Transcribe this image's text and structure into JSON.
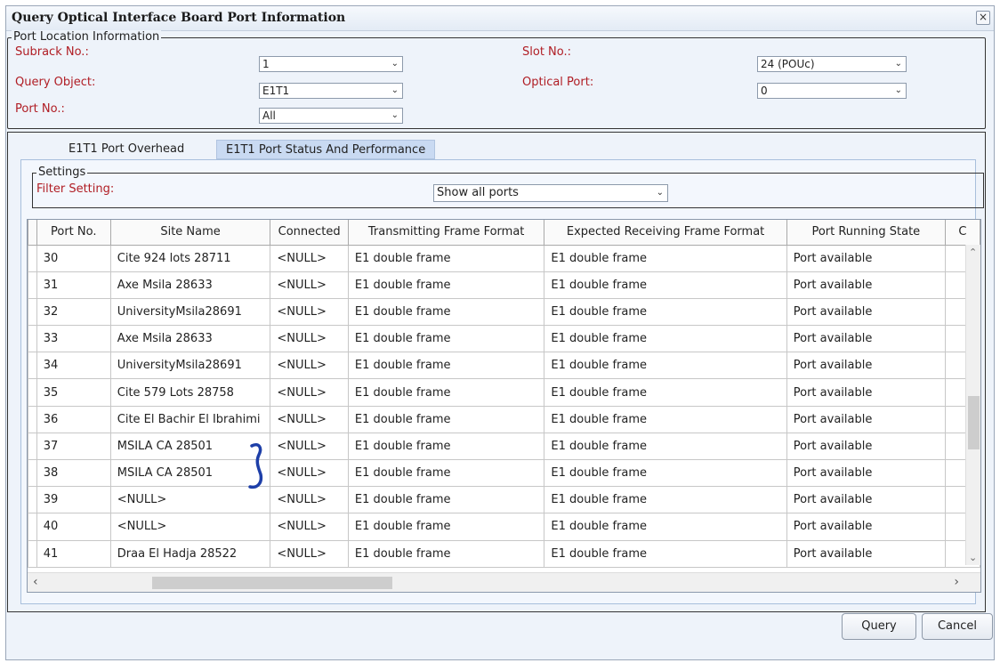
{
  "window": {
    "title": "Query Optical Interface Board Port Information",
    "close_glyph": "×"
  },
  "location": {
    "legend": "Port Location Information",
    "subrack_label": "Subrack No.:",
    "subrack_value": "1",
    "slot_label": "Slot No.:",
    "slot_value": "24 (POUc)",
    "query_object_label": "Query Object:",
    "query_object_value": "E1T1",
    "optical_port_label": "Optical Port:",
    "optical_port_value": "0",
    "port_no_label": "Port No.:",
    "port_no_value": "All"
  },
  "tabs": [
    {
      "label": "E1T1 Port Overhead",
      "active": false
    },
    {
      "label": "E1T1 Port Status And Performance",
      "active": true
    }
  ],
  "settings": {
    "legend": "Settings",
    "filter_label": "Filter Setting:",
    "filter_value": "Show all ports"
  },
  "table": {
    "columns": [
      "Port No.",
      "Site Name",
      "Connected",
      "Transmitting Frame Format",
      "Expected Receiving Frame Format",
      "Port Running State",
      "C"
    ],
    "rows": [
      [
        "30",
        "Cite 924 lots 28711",
        "<NULL>",
        "E1 double frame",
        "E1 double frame",
        "Port available"
      ],
      [
        "31",
        "Axe Msila 28633",
        "<NULL>",
        "E1 double frame",
        "E1 double frame",
        "Port available"
      ],
      [
        "32",
        "UniversityMsila28691",
        "<NULL>",
        "E1 double frame",
        "E1 double frame",
        "Port available"
      ],
      [
        "33",
        "Axe Msila 28633",
        "<NULL>",
        "E1 double frame",
        "E1 double frame",
        "Port available"
      ],
      [
        "34",
        "UniversityMsila28691",
        "<NULL>",
        "E1 double frame",
        "E1 double frame",
        "Port available"
      ],
      [
        "35",
        "Cite 579 Lots 28758",
        "<NULL>",
        "E1 double frame",
        "E1 double frame",
        "Port available"
      ],
      [
        "36",
        "Cite El Bachir El Ibrahimi",
        "<NULL>",
        "E1 double frame",
        "E1 double frame",
        "Port available"
      ],
      [
        "37",
        "MSILA CA 28501",
        "<NULL>",
        "E1 double frame",
        "E1 double frame",
        "Port available"
      ],
      [
        "38",
        "MSILA CA 28501",
        "<NULL>",
        "E1 double frame",
        "E1 double frame",
        "Port available"
      ],
      [
        "39",
        "<NULL>",
        "<NULL>",
        "E1 double frame",
        "E1 double frame",
        "Port available"
      ],
      [
        "40",
        "<NULL>",
        "<NULL>",
        "E1 double frame",
        "E1 double frame",
        "Port available"
      ],
      [
        "41",
        "Draa El Hadja 28522",
        "<NULL>",
        "E1 double frame",
        "E1 double frame",
        "Port available"
      ]
    ]
  },
  "buttons": {
    "query": "Query",
    "cancel": "Cancel"
  },
  "colors": {
    "label_red": "#b01d24",
    "active_tab": "#c9daf2",
    "annotation_blue": "#1e3fa8"
  }
}
